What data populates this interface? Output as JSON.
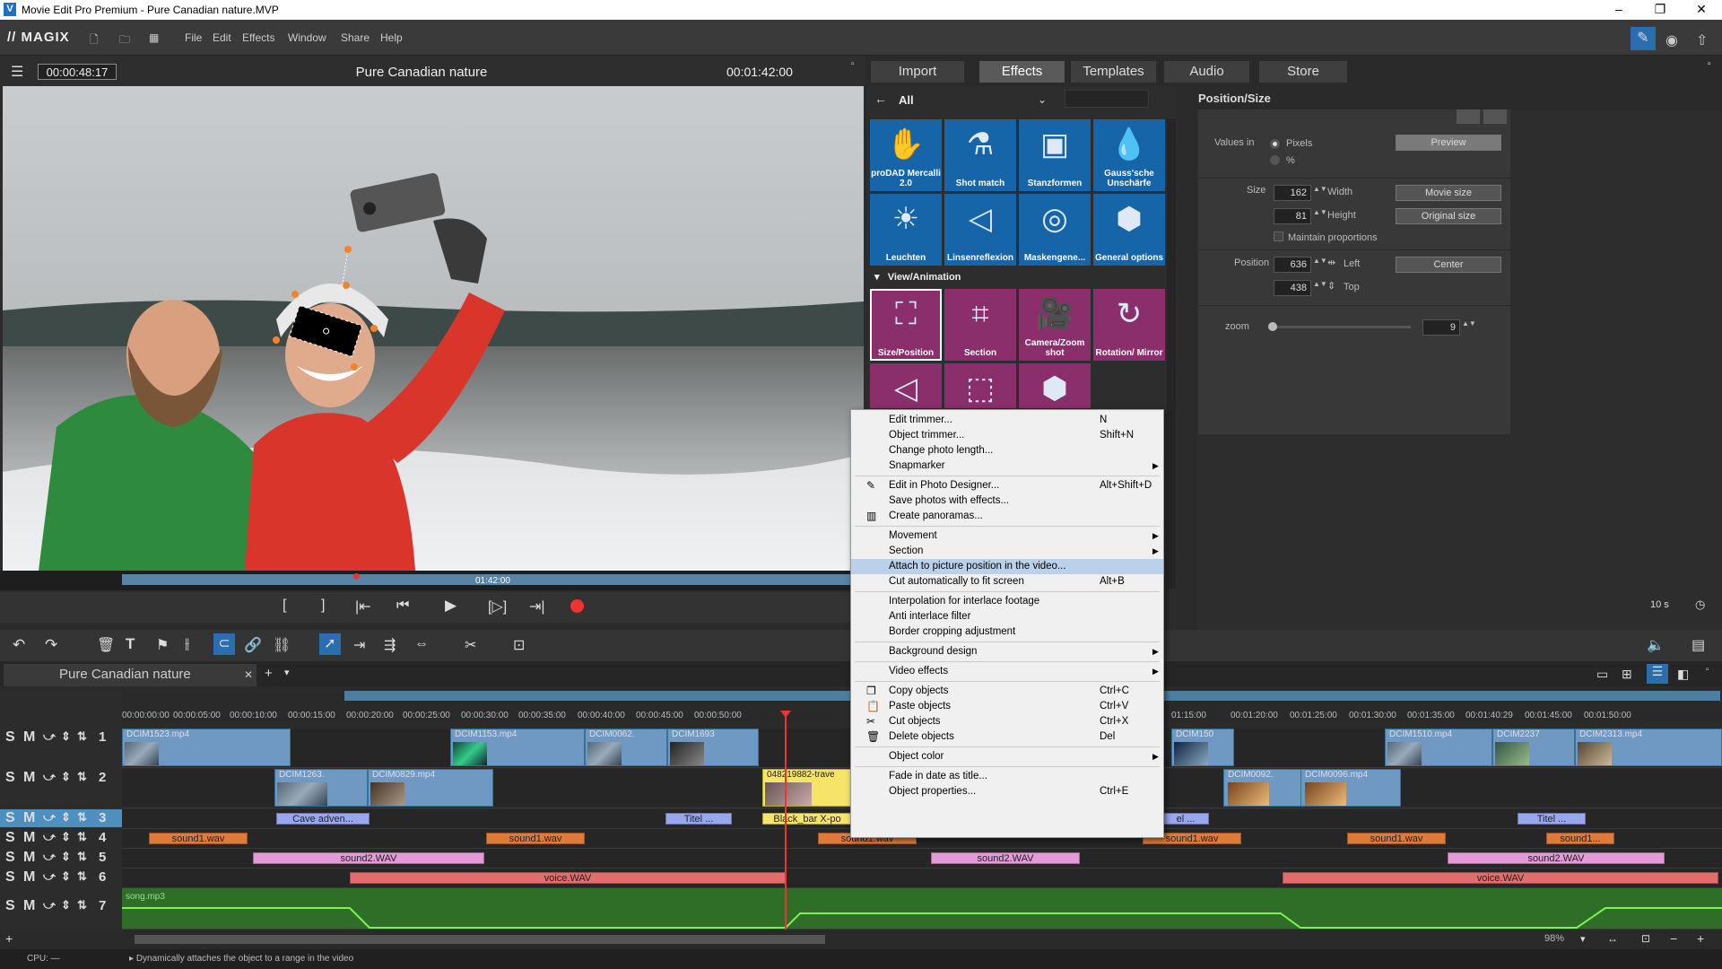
{
  "window": {
    "title": "Movie Edit Pro Premium - Pure Canadian nature.MVP"
  },
  "menubar": {
    "logo": "// MAGIX",
    "items": [
      "File",
      "Edit",
      "Effects",
      "Window",
      "Share",
      "Help"
    ]
  },
  "preview": {
    "timecode_current": "00:00:48:17",
    "title": "Pure Canadian nature",
    "timecode_total": "00:01:42:00",
    "scrub_label": "01:42:00"
  },
  "tabs": [
    "Import",
    "Effects",
    "Templates",
    "Audio",
    "Store"
  ],
  "effects_browser": {
    "filter": "All",
    "tiles_row1": [
      "proDAD Mercalli 2.0",
      "Shot match",
      "Stanzformen",
      "Gauss'sche Unschärfe"
    ],
    "tiles_row2": [
      "Leuchten",
      "Linsenreflexion",
      "Maskengene...",
      "General options"
    ],
    "section": "View/Animation",
    "tiles_row3": [
      "Size/Position",
      "Section",
      "Camera/Zoom shot",
      "Rotation/ Mirror"
    ]
  },
  "position_size": {
    "title": "Position/Size",
    "values_in_label": "Values in",
    "opt_pixels": "Pixels",
    "opt_percent": "%",
    "preview_btn": "Preview",
    "size_label": "Size",
    "width_value": "162",
    "width_label": "Width",
    "height_value": "81",
    "height_label": "Height",
    "movie_size_btn": "Movie size",
    "original_size_btn": "Original size",
    "maintain_label": "Maintain proportions",
    "position_label": "Position",
    "left_value": "636",
    "left_label": "Left",
    "top_value": "438",
    "top_label": "Top",
    "center_btn": "Center",
    "zoom_label": "zoom",
    "zoom_value": "9"
  },
  "context_menu": {
    "items": [
      {
        "label": "Edit trimmer...",
        "shortcut": "N"
      },
      {
        "label": "Object trimmer...",
        "shortcut": "Shift+N"
      },
      {
        "label": "Change photo length...",
        "shortcut": ""
      },
      {
        "label": "Snapmarker",
        "shortcut": ""
      },
      {
        "label": "Edit in Photo Designer...",
        "shortcut": "Alt+Shift+D"
      },
      {
        "label": "Save photos with effects...",
        "shortcut": ""
      },
      {
        "label": "Create panoramas...",
        "shortcut": ""
      },
      {
        "label": "Movement",
        "shortcut": ""
      },
      {
        "label": "Section",
        "shortcut": ""
      },
      {
        "label": "Attach to picture position in the video...",
        "shortcut": ""
      },
      {
        "label": "Cut automatically to fit screen",
        "shortcut": "Alt+B"
      },
      {
        "label": "Interpolation for interlace footage",
        "shortcut": ""
      },
      {
        "label": "Anti interlace filter",
        "shortcut": ""
      },
      {
        "label": "Border cropping adjustment",
        "shortcut": ""
      },
      {
        "label": "Background design",
        "shortcut": ""
      },
      {
        "label": "Video effects",
        "shortcut": ""
      },
      {
        "label": "Copy objects",
        "shortcut": "Ctrl+C"
      },
      {
        "label": "Paste objects",
        "shortcut": "Ctrl+V"
      },
      {
        "label": "Cut objects",
        "shortcut": "Ctrl+X"
      },
      {
        "label": "Delete objects",
        "shortcut": "Del"
      },
      {
        "label": "Object color",
        "shortcut": ""
      },
      {
        "label": "Fade in date as title...",
        "shortcut": ""
      },
      {
        "label": "Object properties...",
        "shortcut": "Ctrl+E"
      }
    ]
  },
  "timeline": {
    "project_tab": "Pure Canadian nature",
    "zoom_label": "10 s",
    "ruler": [
      "00:00:00:00",
      "00:00:05:00",
      "00:00:10:00",
      "00:00:15:00",
      "00:00:20:00",
      "00:00:25:00",
      "00:00:30:00",
      "00:00:35:00",
      "00:00:40:00",
      "00:00:45:00",
      "00:00:50:00",
      "01:15:00",
      "00:01:20:00",
      "00:01:25:00",
      "00:01:30:00",
      "00:01:35:00",
      "00:01:40:29",
      "00:01:45:00",
      "00:01:50:00"
    ],
    "tracks": [
      "1",
      "2",
      "3",
      "4",
      "5",
      "6",
      "7"
    ],
    "video_clips_t1": [
      "DCIM1523.mp4",
      "DCIM1153.mp4",
      "DCIM0062.",
      "DCIM1693",
      "DCIM150",
      "DCIM1510.mp4",
      "DCIM2237",
      "DCIM2313.mp4"
    ],
    "video_clips_t2": [
      "DCIM1263.",
      "DCIM0829.mp4",
      "048219882-trave",
      "DCIM0092.",
      "DCIM0096.mp4"
    ],
    "titles_t3": [
      "Cave adven...",
      "Titel ...",
      "Black_bar X-po",
      "el ...",
      "Titel ..."
    ],
    "audio_t4": [
      "sound1.wav",
      "sound1.wav",
      "sound1.wav",
      "sound1.wav",
      "sound1.wav",
      "sound1..."
    ],
    "audio_t5": [
      "sound2.WAV",
      "sound2.WAV",
      "sound2.WAV"
    ],
    "audio_t6": [
      "voice.WAV",
      "voice.WAV"
    ],
    "audio_t7": "song.mp3",
    "zoom_pct": "98%"
  },
  "status": {
    "cpu": "CPU: —",
    "hint": "Dynamically attaches the object to a range in the video"
  },
  "colors": {
    "effect_blue": "#1565a8",
    "effect_purple": "#8a2e6c",
    "highlight": "#b9d1ea"
  }
}
